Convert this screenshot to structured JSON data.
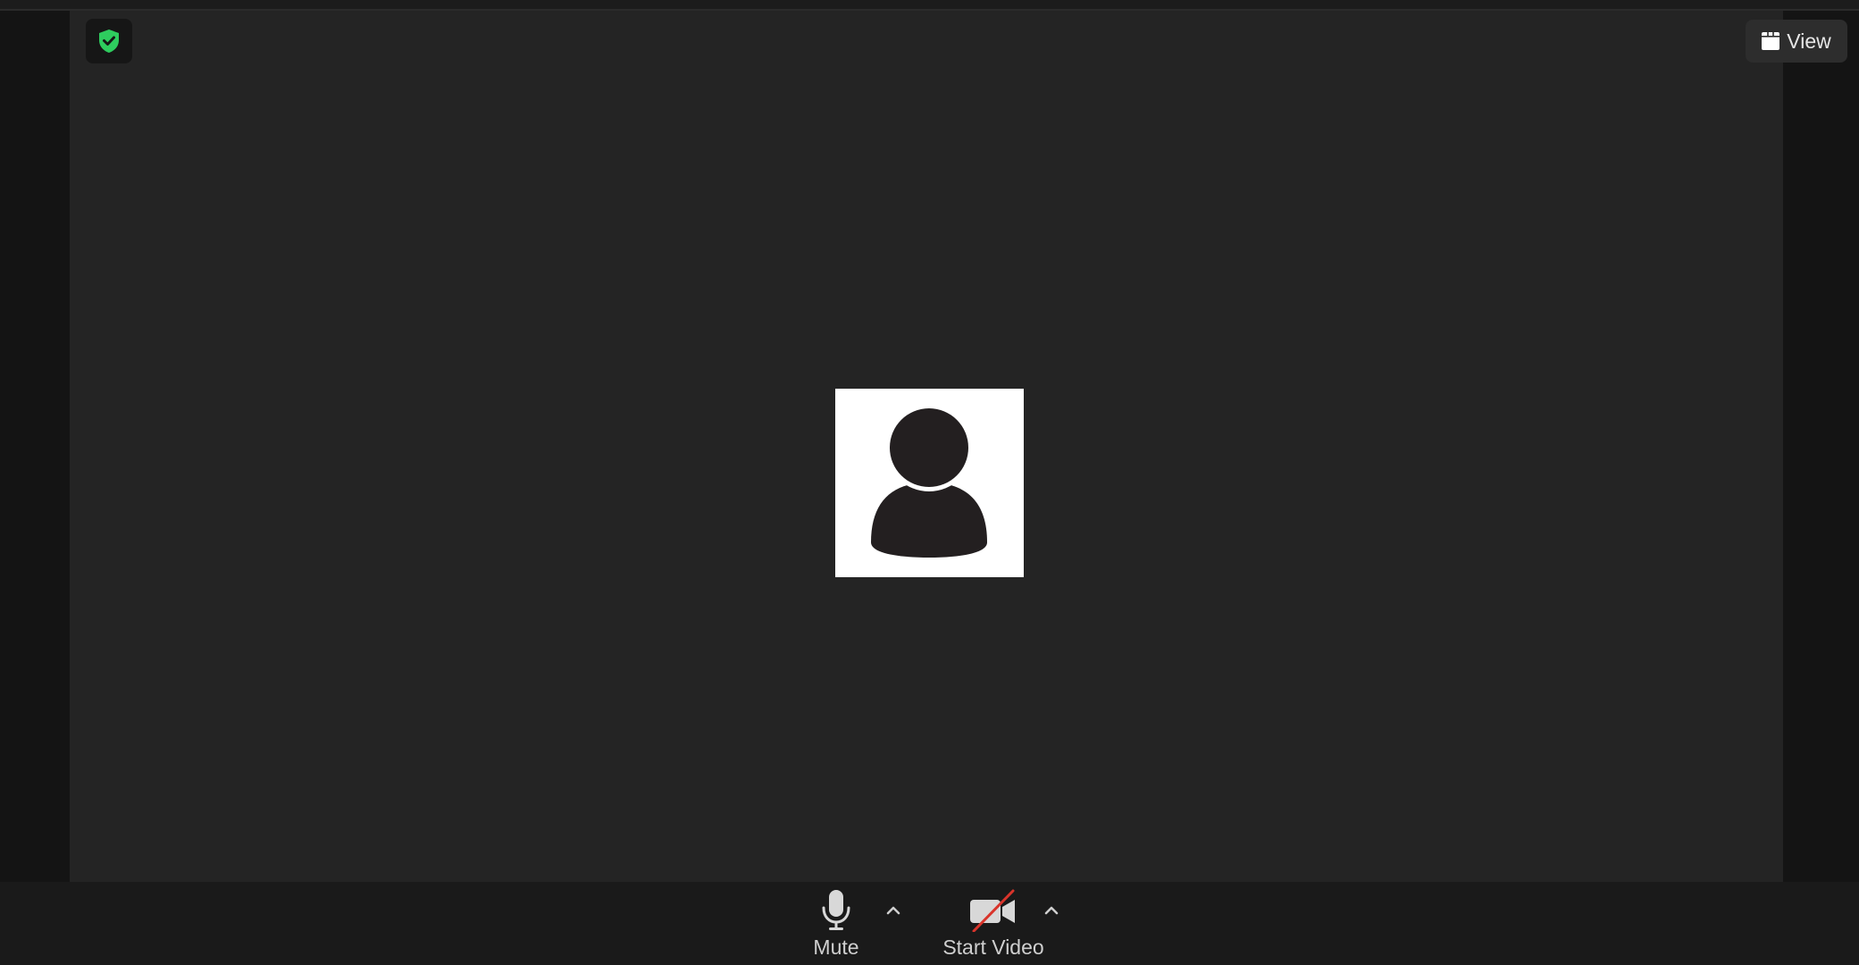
{
  "meeting": {
    "security_icon": "shield-check-icon",
    "security_color": "#2ecc5e",
    "view_label": "View",
    "view_icon": "grid-icon",
    "participant_avatar": "person-icon"
  },
  "toolbar": {
    "mute_label": "Mute",
    "mute_icon": "microphone-icon",
    "start_video_label": "Start Video",
    "start_video_icon": "camera-off-icon",
    "caret_icon": "chevron-up-icon",
    "video_off_slash_color": "#d9342b"
  }
}
